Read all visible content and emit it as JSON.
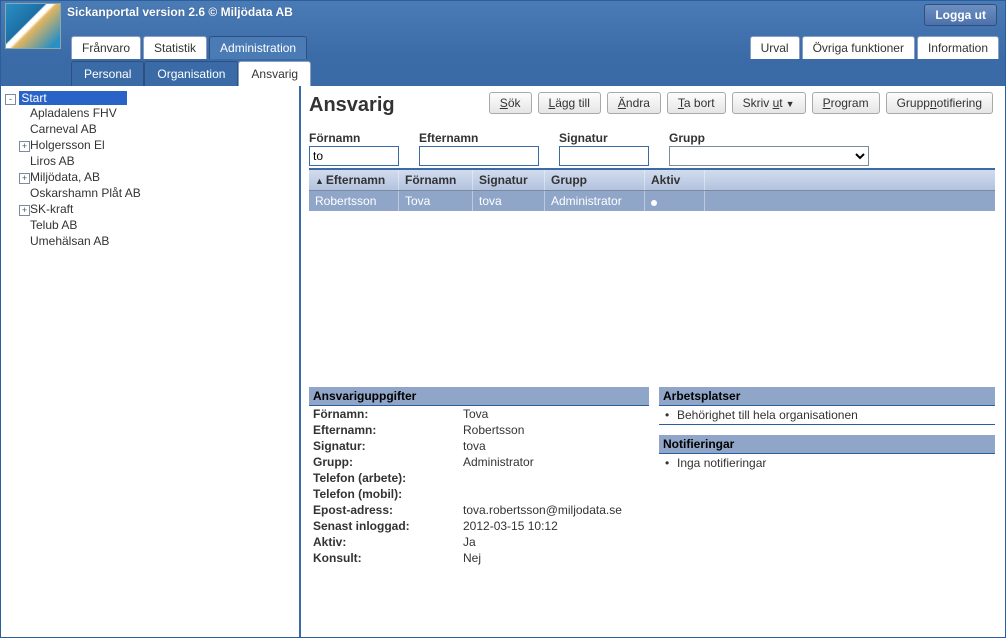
{
  "header": {
    "title": "Sickanportal version 2.6   © Miljödata AB",
    "logout": "Logga ut"
  },
  "top_tabs_left": [
    {
      "label": "Frånvaro",
      "active": false
    },
    {
      "label": "Statistik",
      "active": false
    },
    {
      "label": "Administration",
      "active": true
    }
  ],
  "top_tabs_right": [
    {
      "label": "Urval"
    },
    {
      "label": "Övriga funktioner"
    },
    {
      "label": "Information"
    }
  ],
  "sub_tabs": [
    {
      "label": "Personal",
      "active": false
    },
    {
      "label": "Organisation",
      "active": false
    },
    {
      "label": "Ansvarig",
      "active": true
    }
  ],
  "tree": {
    "root": {
      "label": "Start",
      "expander": "-",
      "selected": true
    },
    "children": [
      {
        "label": "Apladalens FHV",
        "expander": null
      },
      {
        "label": "Carneval AB",
        "expander": null
      },
      {
        "label": "Holgersson El",
        "expander": "+"
      },
      {
        "label": "Liros AB",
        "expander": null
      },
      {
        "label": "Miljödata, AB",
        "expander": "+"
      },
      {
        "label": "Oskarshamn Plåt AB",
        "expander": null
      },
      {
        "label": "SK-kraft",
        "expander": "+"
      },
      {
        "label": "Telub AB",
        "expander": null
      },
      {
        "label": "Umehälsan AB",
        "expander": null
      }
    ]
  },
  "page": {
    "title": "Ansvarig"
  },
  "toolbar": {
    "sok": "Sök",
    "lagg_till": "Lägg till",
    "andra": "Ändra",
    "ta_bort": "Ta bort",
    "skriv_ut": "Skriv ut",
    "program": "Program",
    "gruppnotifiering": "Gruppnotifiering"
  },
  "filters": {
    "fornamn_label": "Förnamn",
    "fornamn_value": "to",
    "efternamn_label": "Efternamn",
    "efternamn_value": "",
    "signatur_label": "Signatur",
    "signatur_value": "",
    "grupp_label": "Grupp",
    "grupp_value": ""
  },
  "grid": {
    "columns": {
      "efternamn": "Efternamn",
      "fornamn": "Förnamn",
      "signatur": "Signatur",
      "grupp": "Grupp",
      "aktiv": "Aktiv"
    },
    "rows": [
      {
        "efternamn": "Robertsson",
        "fornamn": "Tova",
        "signatur": "tova",
        "grupp": "Administrator",
        "aktiv": true
      }
    ]
  },
  "details_left": {
    "heading": "Ansvariguppgifter",
    "items": {
      "fornamn_k": "Förnamn:",
      "fornamn_v": "Tova",
      "efternamn_k": "Efternamn:",
      "efternamn_v": "Robertsson",
      "signatur_k": "Signatur:",
      "signatur_v": "tova",
      "grupp_k": "Grupp:",
      "grupp_v": "Administrator",
      "tel_arbete_k": "Telefon (arbete):",
      "tel_arbete_v": "",
      "tel_mobil_k": "Telefon (mobil):",
      "tel_mobil_v": "",
      "epost_k": "Epost-adress:",
      "epost_v": "tova.robertsson@miljodata.se",
      "senast_k": "Senast inloggad:",
      "senast_v": "2012-03-15 10:12",
      "aktiv_k": "Aktiv:",
      "aktiv_v": "Ja",
      "konsult_k": "Konsult:",
      "konsult_v": "Nej"
    }
  },
  "details_right": {
    "arbetsplatser_heading": "Arbetsplatser",
    "arbetsplatser_item": "Behörighet till hela organisationen",
    "notifieringar_heading": "Notifieringar",
    "notifieringar_item": "Inga notifieringar"
  }
}
